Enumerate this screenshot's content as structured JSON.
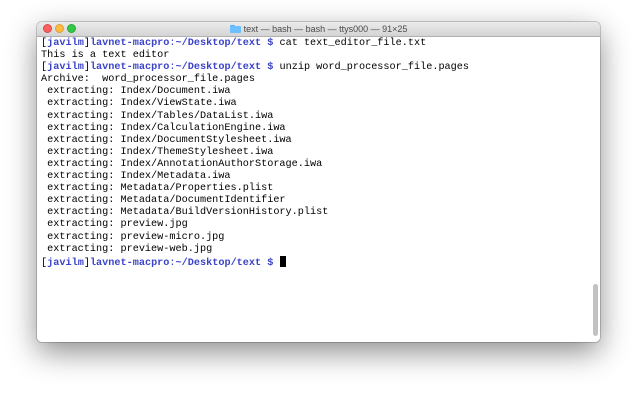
{
  "window": {
    "title": "text — bash — bash — ttys000 — 91×25"
  },
  "terminal": {
    "prompt": {
      "open_bracket": "[",
      "user": "javilm",
      "close_bracket": "]",
      "host": "lavnet-macpro",
      "colon": ":",
      "path": "~/Desktop/text",
      "dollar": " $"
    },
    "lines": [
      {
        "type": "prompt",
        "command": " cat text_editor_file.txt"
      },
      {
        "type": "output",
        "text": "This is a text editor"
      },
      {
        "type": "prompt",
        "command": " unzip word_processor_file.pages"
      },
      {
        "type": "output",
        "text": "Archive:  word_processor_file.pages"
      },
      {
        "type": "output",
        "text": " extracting: Index/Document.iwa"
      },
      {
        "type": "output",
        "text": " extracting: Index/ViewState.iwa"
      },
      {
        "type": "output",
        "text": " extracting: Index/Tables/DataList.iwa"
      },
      {
        "type": "output",
        "text": " extracting: Index/CalculationEngine.iwa"
      },
      {
        "type": "output",
        "text": " extracting: Index/DocumentStylesheet.iwa"
      },
      {
        "type": "output",
        "text": " extracting: Index/ThemeStylesheet.iwa"
      },
      {
        "type": "output",
        "text": " extracting: Index/AnnotationAuthorStorage.iwa"
      },
      {
        "type": "output",
        "text": " extracting: Index/Metadata.iwa"
      },
      {
        "type": "output",
        "text": " extracting: Metadata/Properties.plist"
      },
      {
        "type": "output",
        "text": " extracting: Metadata/DocumentIdentifier"
      },
      {
        "type": "output",
        "text": " extracting: Metadata/BuildVersionHistory.plist"
      },
      {
        "type": "output",
        "text": " extracting: preview.jpg"
      },
      {
        "type": "output",
        "text": " extracting: preview-micro.jpg"
      },
      {
        "type": "output",
        "text": " extracting: preview-web.jpg"
      },
      {
        "type": "prompt",
        "command": " ",
        "cursor": true
      }
    ]
  },
  "icons": {
    "folder": "folder-icon",
    "split_pane": "split-pane-icon"
  },
  "colors": {
    "prompt": "#3b43c8",
    "close": "#fc605c",
    "minimize": "#fdbc40",
    "maximize": "#34c84a"
  }
}
